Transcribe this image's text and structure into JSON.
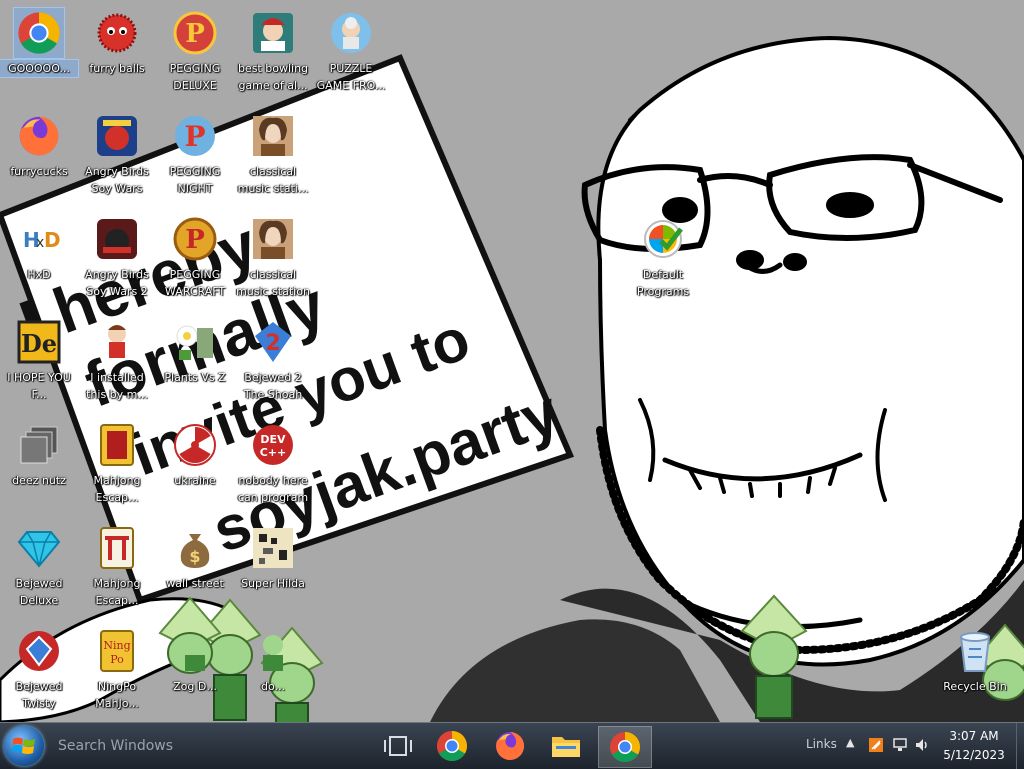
{
  "wallpaper": {
    "sign_lines": [
      "I hereby",
      "formally",
      "invite you to",
      "soyjak.party"
    ]
  },
  "desktop_icons": [
    {
      "label": "GOOOOO...",
      "icon": "chrome-icon",
      "selected": true
    },
    {
      "label": "furry balls",
      "icon": "red-fuzzy-ball-icon"
    },
    {
      "label": "PEGGING DELUXE",
      "icon": "pegging-logo-icon"
    },
    {
      "label": "best bowling game of al...",
      "icon": "bowling-game-icon"
    },
    {
      "label": "PUZZLE GAME FRO...",
      "icon": "puzzle-game-icon"
    },
    {
      "label": "furrycucks",
      "icon": "firefox-icon"
    },
    {
      "label": "Angry Birds Soy Wars",
      "icon": "angry-birds-star-wars-icon"
    },
    {
      "label": "PEGGING NIGHT",
      "icon": "pegging-night-icon"
    },
    {
      "label": "classical music stati...",
      "icon": "classical-portrait-icon"
    },
    {
      "label": "HxD",
      "icon": "hxd-hex-editor-icon"
    },
    {
      "label": "Angry Birds Soy Wars 2",
      "icon": "angry-birds-star-wars-2-icon"
    },
    {
      "label": "PEGGING WARCRAFT",
      "icon": "pegging-warcraft-icon"
    },
    {
      "label": "classical music station",
      "icon": "classical-portrait-icon"
    },
    {
      "label": "Default Programs",
      "icon": "default-programs-icon"
    },
    {
      "label": "I HOPE YOU F...",
      "icon": "de-app-icon"
    },
    {
      "label": "I installed this by m...",
      "icon": "cartoon-character-icon"
    },
    {
      "label": "Plants Vs Z",
      "icon": "plants-vs-zombies-icon"
    },
    {
      "label": "Bejewed 2 The Shoah",
      "icon": "bejeweled-2-icon"
    },
    {
      "label": "deez nutz",
      "icon": "stacked-windows-icon"
    },
    {
      "label": "Mahjong Escap...",
      "icon": "mahjong-tile-icon"
    },
    {
      "label": "ukraine",
      "icon": "radiation-icon"
    },
    {
      "label": "nobody here can program",
      "icon": "dev-cpp-icon"
    },
    {
      "label": "Bejewed Deluxe",
      "icon": "blue-diamond-icon"
    },
    {
      "label": "Mahjong Escap...",
      "icon": "mahjong-gate-icon"
    },
    {
      "label": "wall street",
      "icon": "money-bag-icon"
    },
    {
      "label": "Super Hilda",
      "icon": "pixel-art-icon"
    },
    {
      "label": "Bejewed Twisty",
      "icon": "bejeweled-twist-icon"
    },
    {
      "label": "NingPo MahJo...",
      "icon": "ningpo-mahjong-icon"
    },
    {
      "label": "Zog D...",
      "icon": "character-icon"
    },
    {
      "label": "do...",
      "icon": "character-icon"
    },
    {
      "label": "Recycle Bin",
      "icon": "recycle-bin-icon"
    }
  ],
  "taskbar": {
    "search_placeholder": "Search Windows",
    "links_label": "Links",
    "chevron": "▲",
    "clock_time": "3:07 AM",
    "clock_date": "5/12/2023",
    "pinned": [
      {
        "name": "task-view-button",
        "icon": "task-view-icon"
      },
      {
        "name": "taskbar-chrome",
        "icon": "chrome-icon"
      },
      {
        "name": "taskbar-firefox",
        "icon": "firefox-icon"
      },
      {
        "name": "taskbar-file-explorer",
        "icon": "folder-icon"
      },
      {
        "name": "taskbar-chrome-active",
        "icon": "chrome-icon",
        "active": true
      }
    ]
  },
  "colors": {
    "taskbar": "#1c232c",
    "wallpaper_bg": "#a9a9a9",
    "selection": "#78aae6"
  }
}
